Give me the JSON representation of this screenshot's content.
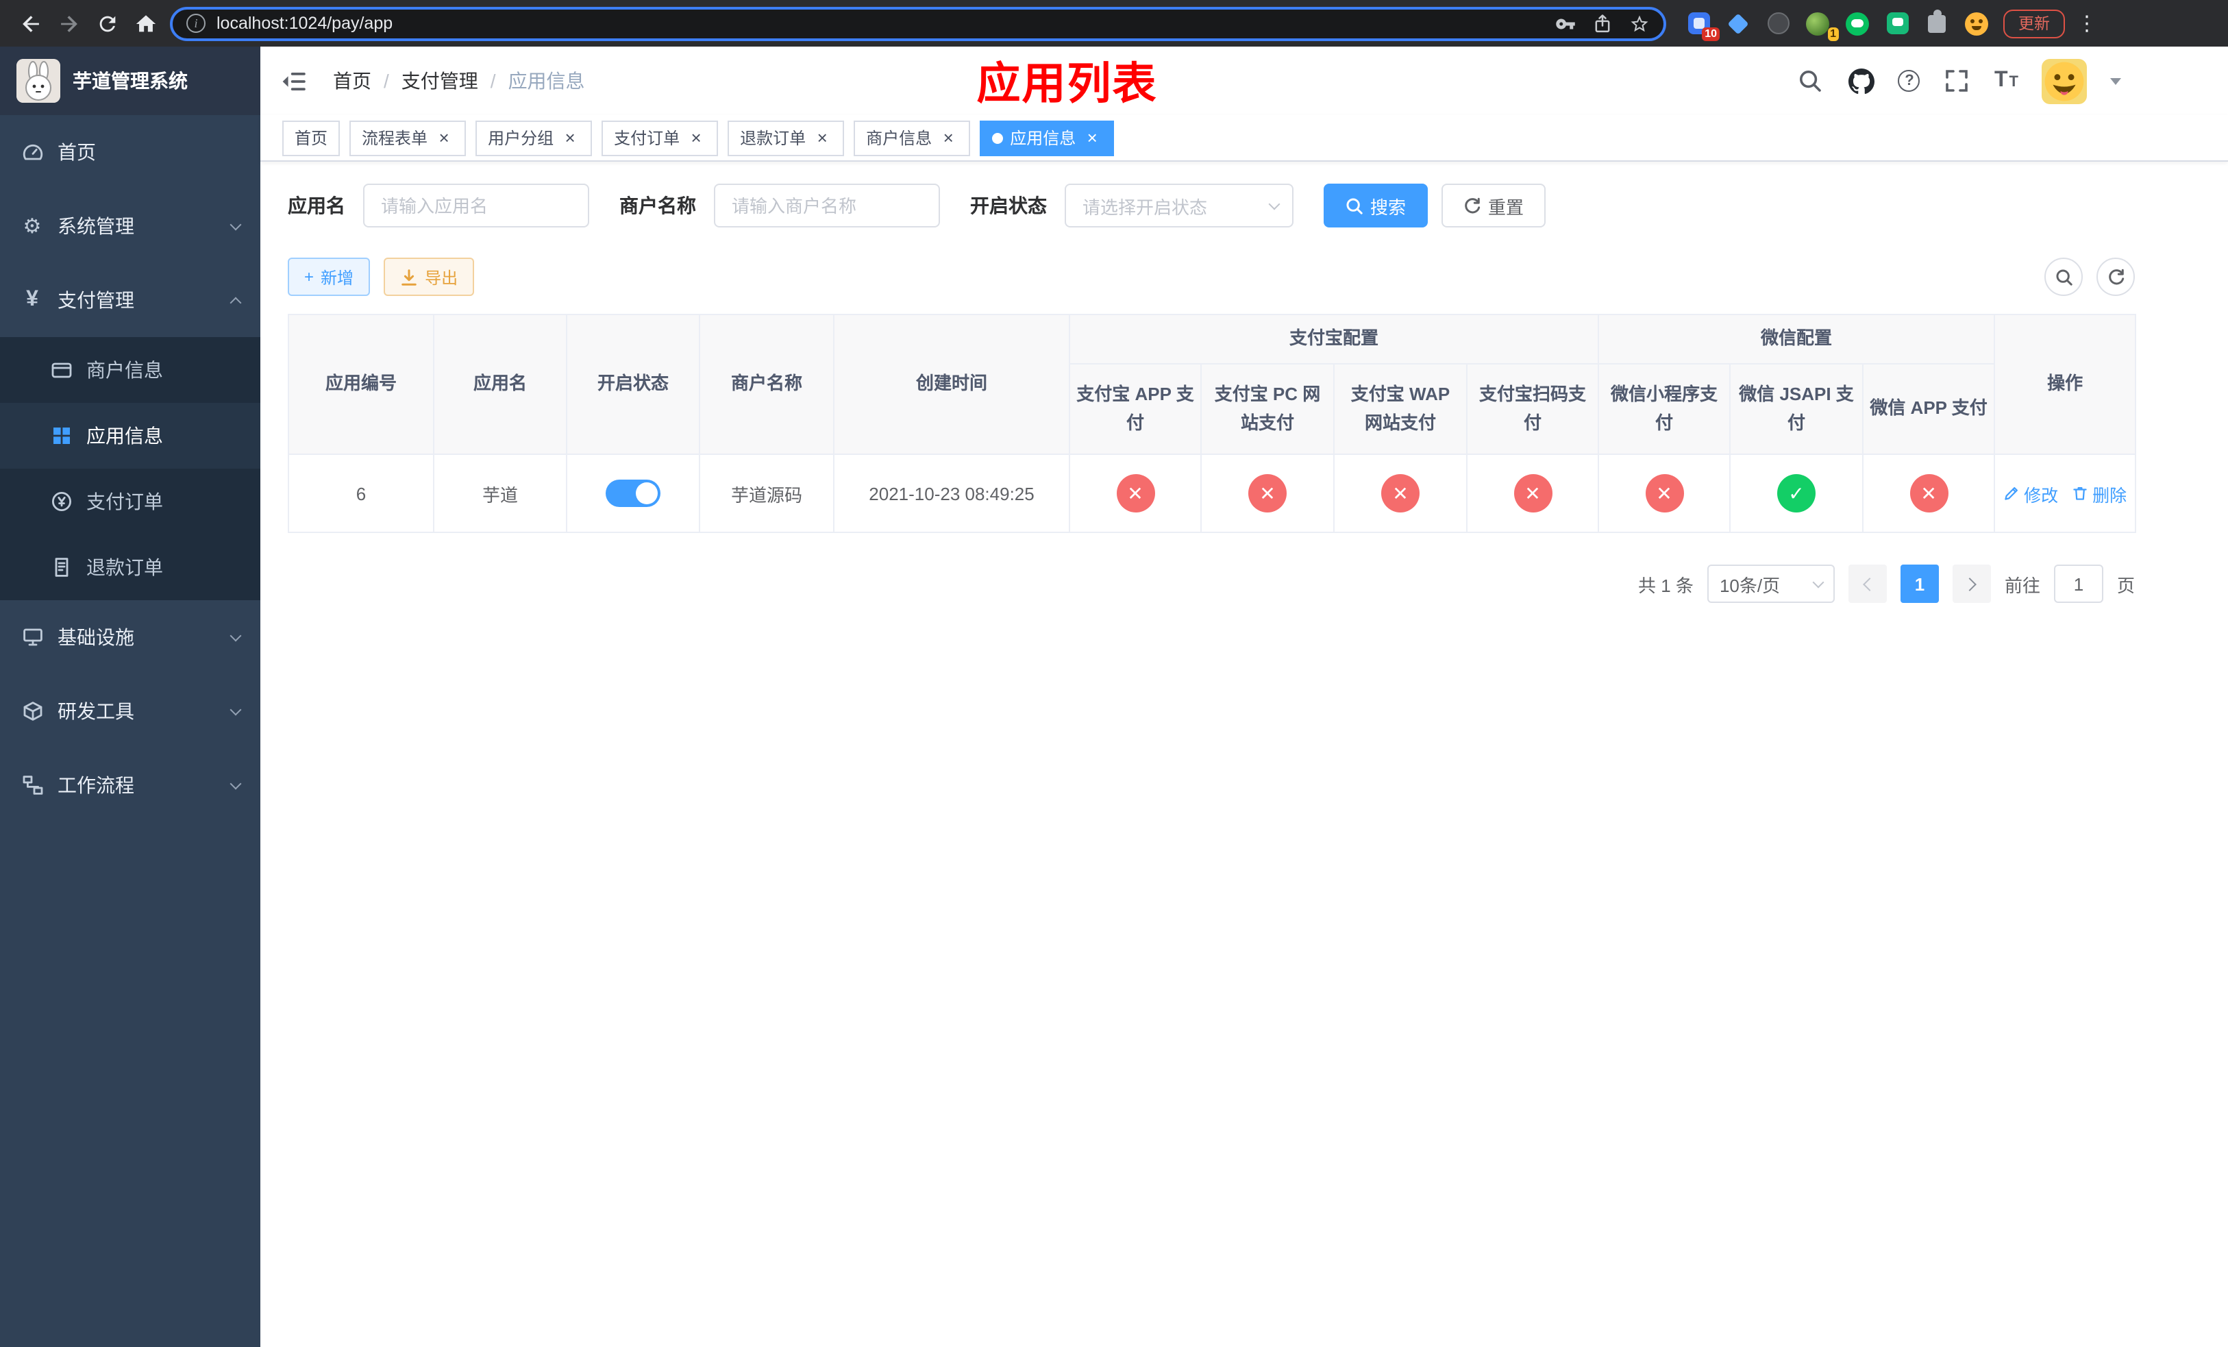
{
  "glyphs": {
    "close": "×",
    "more": "⋮",
    "info": "i",
    "help": "?",
    "yen": "¥",
    "gear": "⚙",
    "plus": "+",
    "success": "✓",
    "fail": "✕",
    "size_big": "T",
    "size_small": "T",
    "slash": "/"
  },
  "browser": {
    "url": "localhost:1024/pay/app",
    "update_button": "更新",
    "extension_badge": "10",
    "profile_badge": "1"
  },
  "sidebar": {
    "logo_title": "芋道管理系统",
    "menu": [
      {
        "label": "首页"
      },
      {
        "label": "系统管理"
      },
      {
        "label": "支付管理"
      },
      {
        "label": "基础设施"
      },
      {
        "label": "研发工具"
      },
      {
        "label": "工作流程"
      }
    ],
    "submenu": [
      {
        "label": "商户信息"
      },
      {
        "label": "应用信息",
        "active": true
      },
      {
        "label": "支付订单"
      },
      {
        "label": "退款订单"
      }
    ]
  },
  "header": {
    "breadcrumb": [
      "首页",
      "支付管理",
      "应用信息"
    ],
    "page_title": "应用列表",
    "title_color": "#ff0000"
  },
  "tabs": [
    {
      "label": "首页",
      "closable": false,
      "active": false
    },
    {
      "label": "流程表单",
      "closable": true,
      "active": false
    },
    {
      "label": "用户分组",
      "closable": true,
      "active": false
    },
    {
      "label": "支付订单",
      "closable": true,
      "active": false
    },
    {
      "label": "退款订单",
      "closable": true,
      "active": false
    },
    {
      "label": "商户信息",
      "closable": true,
      "active": false
    },
    {
      "label": "应用信息",
      "closable": true,
      "active": true
    }
  ],
  "filters": {
    "app_name_label": "应用名",
    "app_name_placeholder": "请输入应用名",
    "merchant_label": "商户名称",
    "merchant_placeholder": "请输入商户名称",
    "status_label": "开启状态",
    "status_placeholder": "请选择开启状态",
    "search_button": "搜索",
    "reset_button": "重置"
  },
  "toolbar": {
    "add_button": "新增",
    "export_button": "导出"
  },
  "table": {
    "group_headers": {
      "alipay": "支付宝配置",
      "wechat": "微信配置"
    },
    "columns": [
      "应用编号",
      "应用名",
      "开启状态",
      "商户名称",
      "创建时间",
      "支付宝 APP 支付",
      "支付宝 PC 网站支付",
      "支付宝 WAP 网站支付",
      "支付宝扫码支付",
      "微信小程序支付",
      "微信 JSAPI 支付",
      "微信 APP 支付",
      "操作"
    ],
    "rows": [
      {
        "id": "6",
        "name": "芋道",
        "enabled": true,
        "merchant": "芋道源码",
        "created_at": "2021-10-23 08:49:25",
        "alipay_app": false,
        "alipay_pc": false,
        "alipay_wap": false,
        "alipay_qr": false,
        "wx_mini": false,
        "wx_jsapi": true,
        "wx_app": false,
        "actions": [
          "修改",
          "删除"
        ]
      }
    ]
  },
  "pagination": {
    "total_text": "共 1 条",
    "page_size": "10条/页",
    "current_page": "1",
    "jump_prefix": "前往",
    "jump_suffix": "页",
    "jump_value": "1"
  },
  "colors": {
    "primary": "#409eff",
    "success": "#13ce66",
    "danger": "#f56c6c",
    "sidebar_bg": "#304156",
    "submenu_bg": "#1f2d3d",
    "title_red": "#ff0000"
  }
}
